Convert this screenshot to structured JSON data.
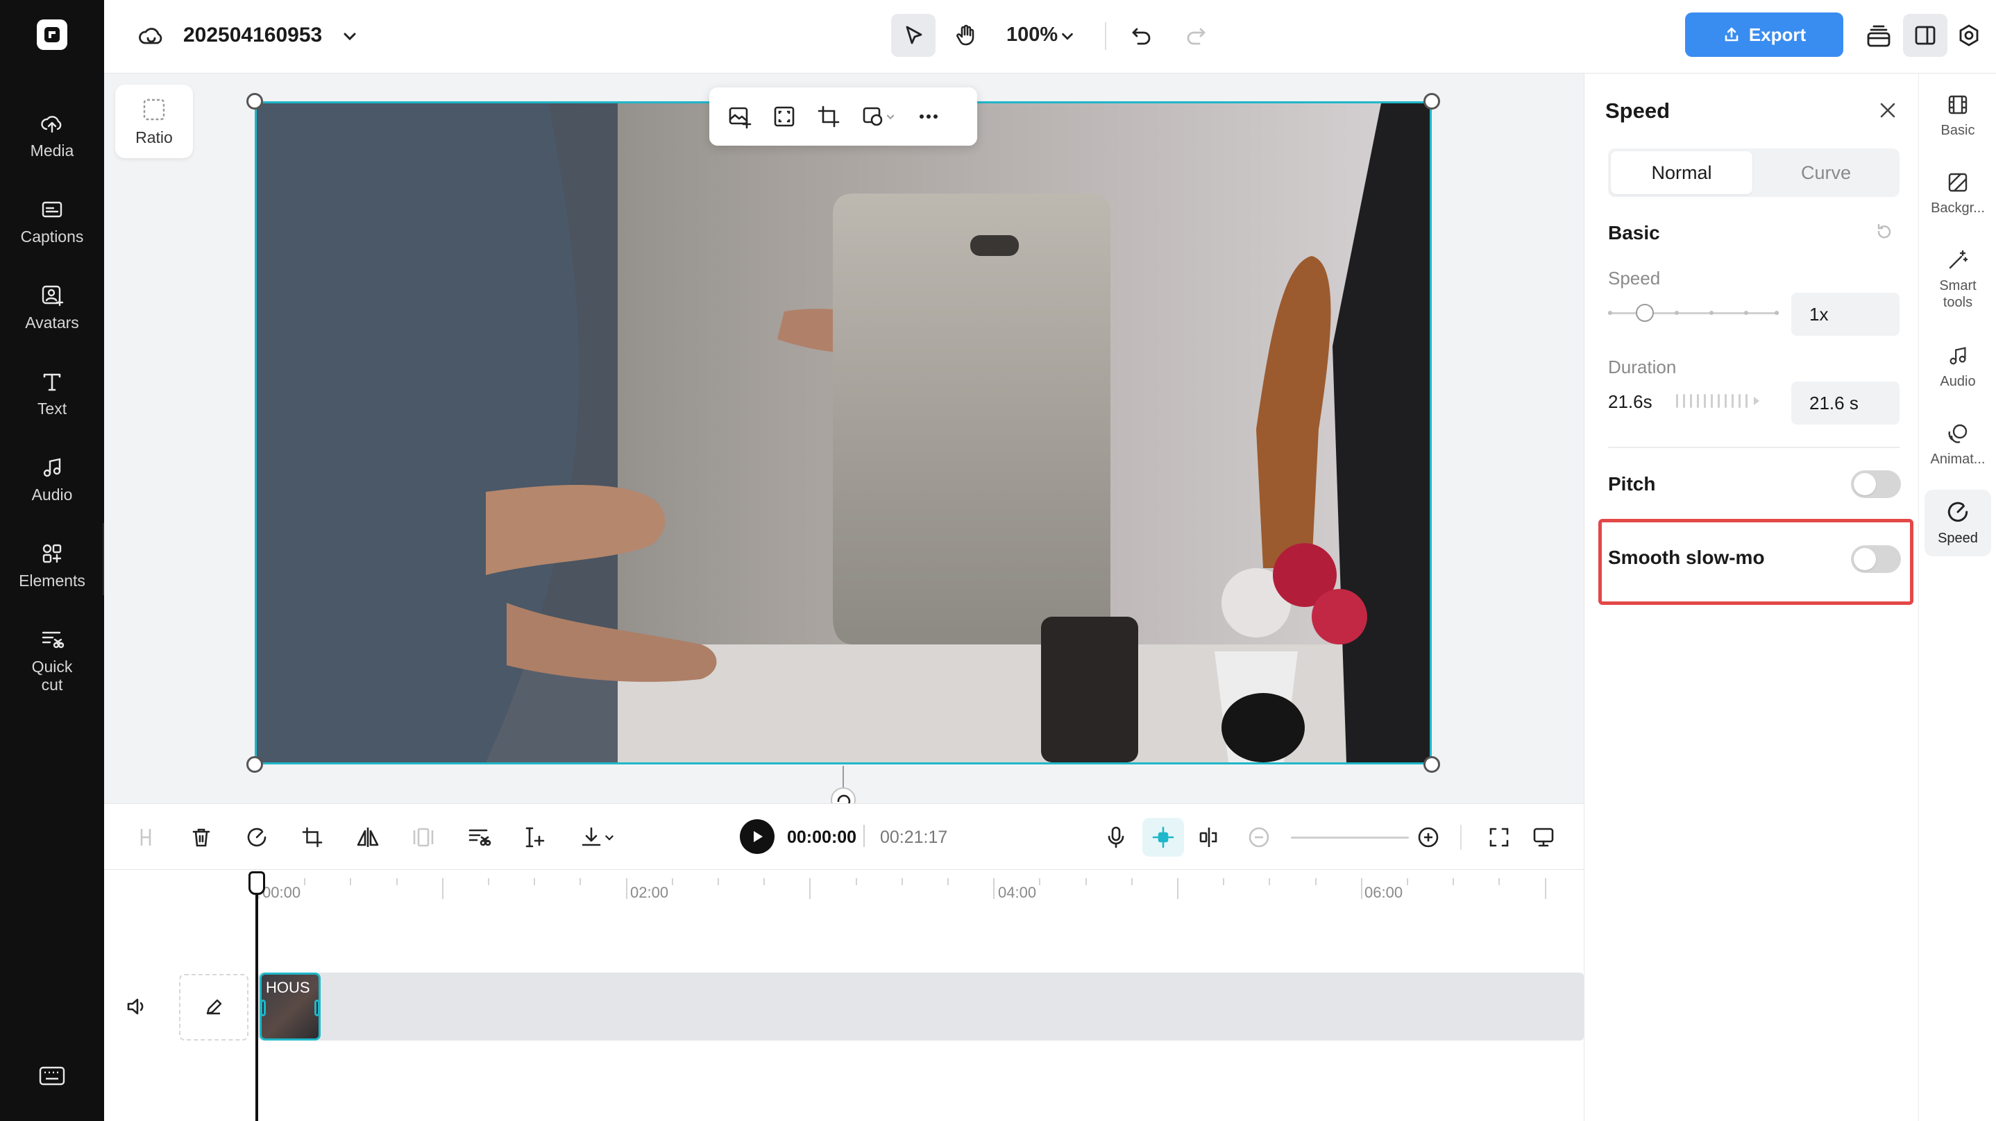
{
  "left_nav": {
    "items": [
      {
        "label": "Media",
        "icon": "cloud-upload-icon"
      },
      {
        "label": "Captions",
        "icon": "captions-icon"
      },
      {
        "label": "Avatars",
        "icon": "avatar-icon"
      },
      {
        "label": "Text",
        "icon": "text-icon"
      },
      {
        "label": "Audio",
        "icon": "music-note-icon"
      },
      {
        "label": "Elements",
        "icon": "elements-icon"
      },
      {
        "label": "Quick cut",
        "icon": "quick-cut-icon"
      }
    ]
  },
  "topbar": {
    "project_title": "202504160953",
    "zoom": "100%",
    "export_label": "Export"
  },
  "canvas": {
    "ratio_label": "Ratio"
  },
  "timeline_toolbar": {
    "current_time": "00:00:00",
    "total_time": "00:21:17"
  },
  "timeline": {
    "ruler": [
      "00:00",
      "02:00",
      "04:00",
      "06:00"
    ],
    "clip_name": "HOUS"
  },
  "panel": {
    "title": "Speed",
    "tabs": [
      {
        "label": "Normal",
        "active": true
      },
      {
        "label": "Curve",
        "active": false
      }
    ],
    "section_basic": "Basic",
    "speed_label": "Speed",
    "speed_value": "1x",
    "duration_label": "Duration",
    "duration_left": "21.6s",
    "duration_value": "21.6 s",
    "pitch_label": "Pitch",
    "pitch_on": false,
    "smooth_label": "Smooth slow-mo",
    "smooth_on": false
  },
  "rail": {
    "items": [
      {
        "label": "Basic",
        "icon": "film-icon"
      },
      {
        "label": "Backgr...",
        "icon": "background-icon"
      },
      {
        "label": "Smart tools",
        "icon": "magic-wand-icon"
      },
      {
        "label": "Audio",
        "icon": "music-note-icon"
      },
      {
        "label": "Animat...",
        "icon": "animation-icon"
      },
      {
        "label": "Speed",
        "icon": "speed-gauge-icon",
        "active": true
      }
    ]
  },
  "colors": {
    "accent": "#1fb7c9",
    "export": "#3a8df0",
    "highlight": "#e34848",
    "sidebar": "#101010"
  }
}
